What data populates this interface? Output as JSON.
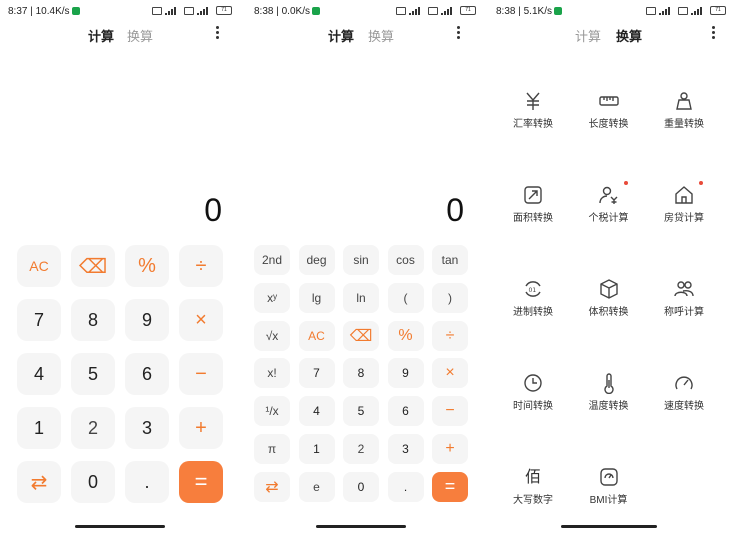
{
  "panel1": {
    "status": {
      "time": "8:37 | 10.4K/s",
      "battery": "71"
    },
    "tabs": {
      "calc": "计算",
      "convert": "换算"
    },
    "display": "0",
    "keys": [
      "AC",
      "⌫",
      "%",
      "÷",
      "7",
      "8",
      "9",
      "×",
      "4",
      "5",
      "6",
      "−",
      "1",
      "2",
      "3",
      "+",
      "⇄",
      "0",
      ".",
      "="
    ]
  },
  "panel2": {
    "status": {
      "time": "8:38 | 0.0K/s",
      "battery": "71"
    },
    "tabs": {
      "calc": "计算",
      "convert": "换算"
    },
    "display": "0",
    "keys": [
      "2nd",
      "deg",
      "sin",
      "cos",
      "tan",
      "xʸ",
      "lg",
      "ln",
      "(",
      ")",
      "√x",
      "AC",
      "⌫",
      "%",
      "÷",
      "x!",
      "7",
      "8",
      "9",
      "×",
      "¹/x",
      "4",
      "5",
      "6",
      "−",
      "π",
      "1",
      "2",
      "3",
      "+",
      "⇄",
      "e",
      "0",
      ".",
      "="
    ]
  },
  "panel3": {
    "status": {
      "time": "8:38 | 5.1K/s",
      "battery": "71"
    },
    "tabs": {
      "calc": "计算",
      "convert": "换算"
    },
    "converters": [
      {
        "label": "汇率转换",
        "icon": "yuan-icon",
        "dot": false
      },
      {
        "label": "长度转换",
        "icon": "ruler-icon",
        "dot": false
      },
      {
        "label": "重量转换",
        "icon": "weight-icon",
        "dot": false
      },
      {
        "label": "面积转换",
        "icon": "area-icon",
        "dot": false
      },
      {
        "label": "个税计算",
        "icon": "tax-icon",
        "dot": true
      },
      {
        "label": "房贷计算",
        "icon": "house-icon",
        "dot": true
      },
      {
        "label": "进制转换",
        "icon": "base-icon",
        "dot": false
      },
      {
        "label": "体积转换",
        "icon": "cube-icon",
        "dot": false
      },
      {
        "label": "称呼计算",
        "icon": "people-icon",
        "dot": false
      },
      {
        "label": "时间转换",
        "icon": "clock-icon",
        "dot": false
      },
      {
        "label": "温度转换",
        "icon": "thermometer-icon",
        "dot": false
      },
      {
        "label": "速度转换",
        "icon": "speedometer-icon",
        "dot": false
      },
      {
        "label": "大写数字",
        "icon": "bai-icon",
        "glyph": "佰",
        "dot": false
      },
      {
        "label": "BMI计算",
        "icon": "bmi-scale-icon",
        "dot": false
      }
    ]
  },
  "colors": {
    "accent": "#f27b2f",
    "equals_bg": "#f77e3d",
    "key_bg": "#f5f5f5",
    "dot": "#e84b3a"
  }
}
